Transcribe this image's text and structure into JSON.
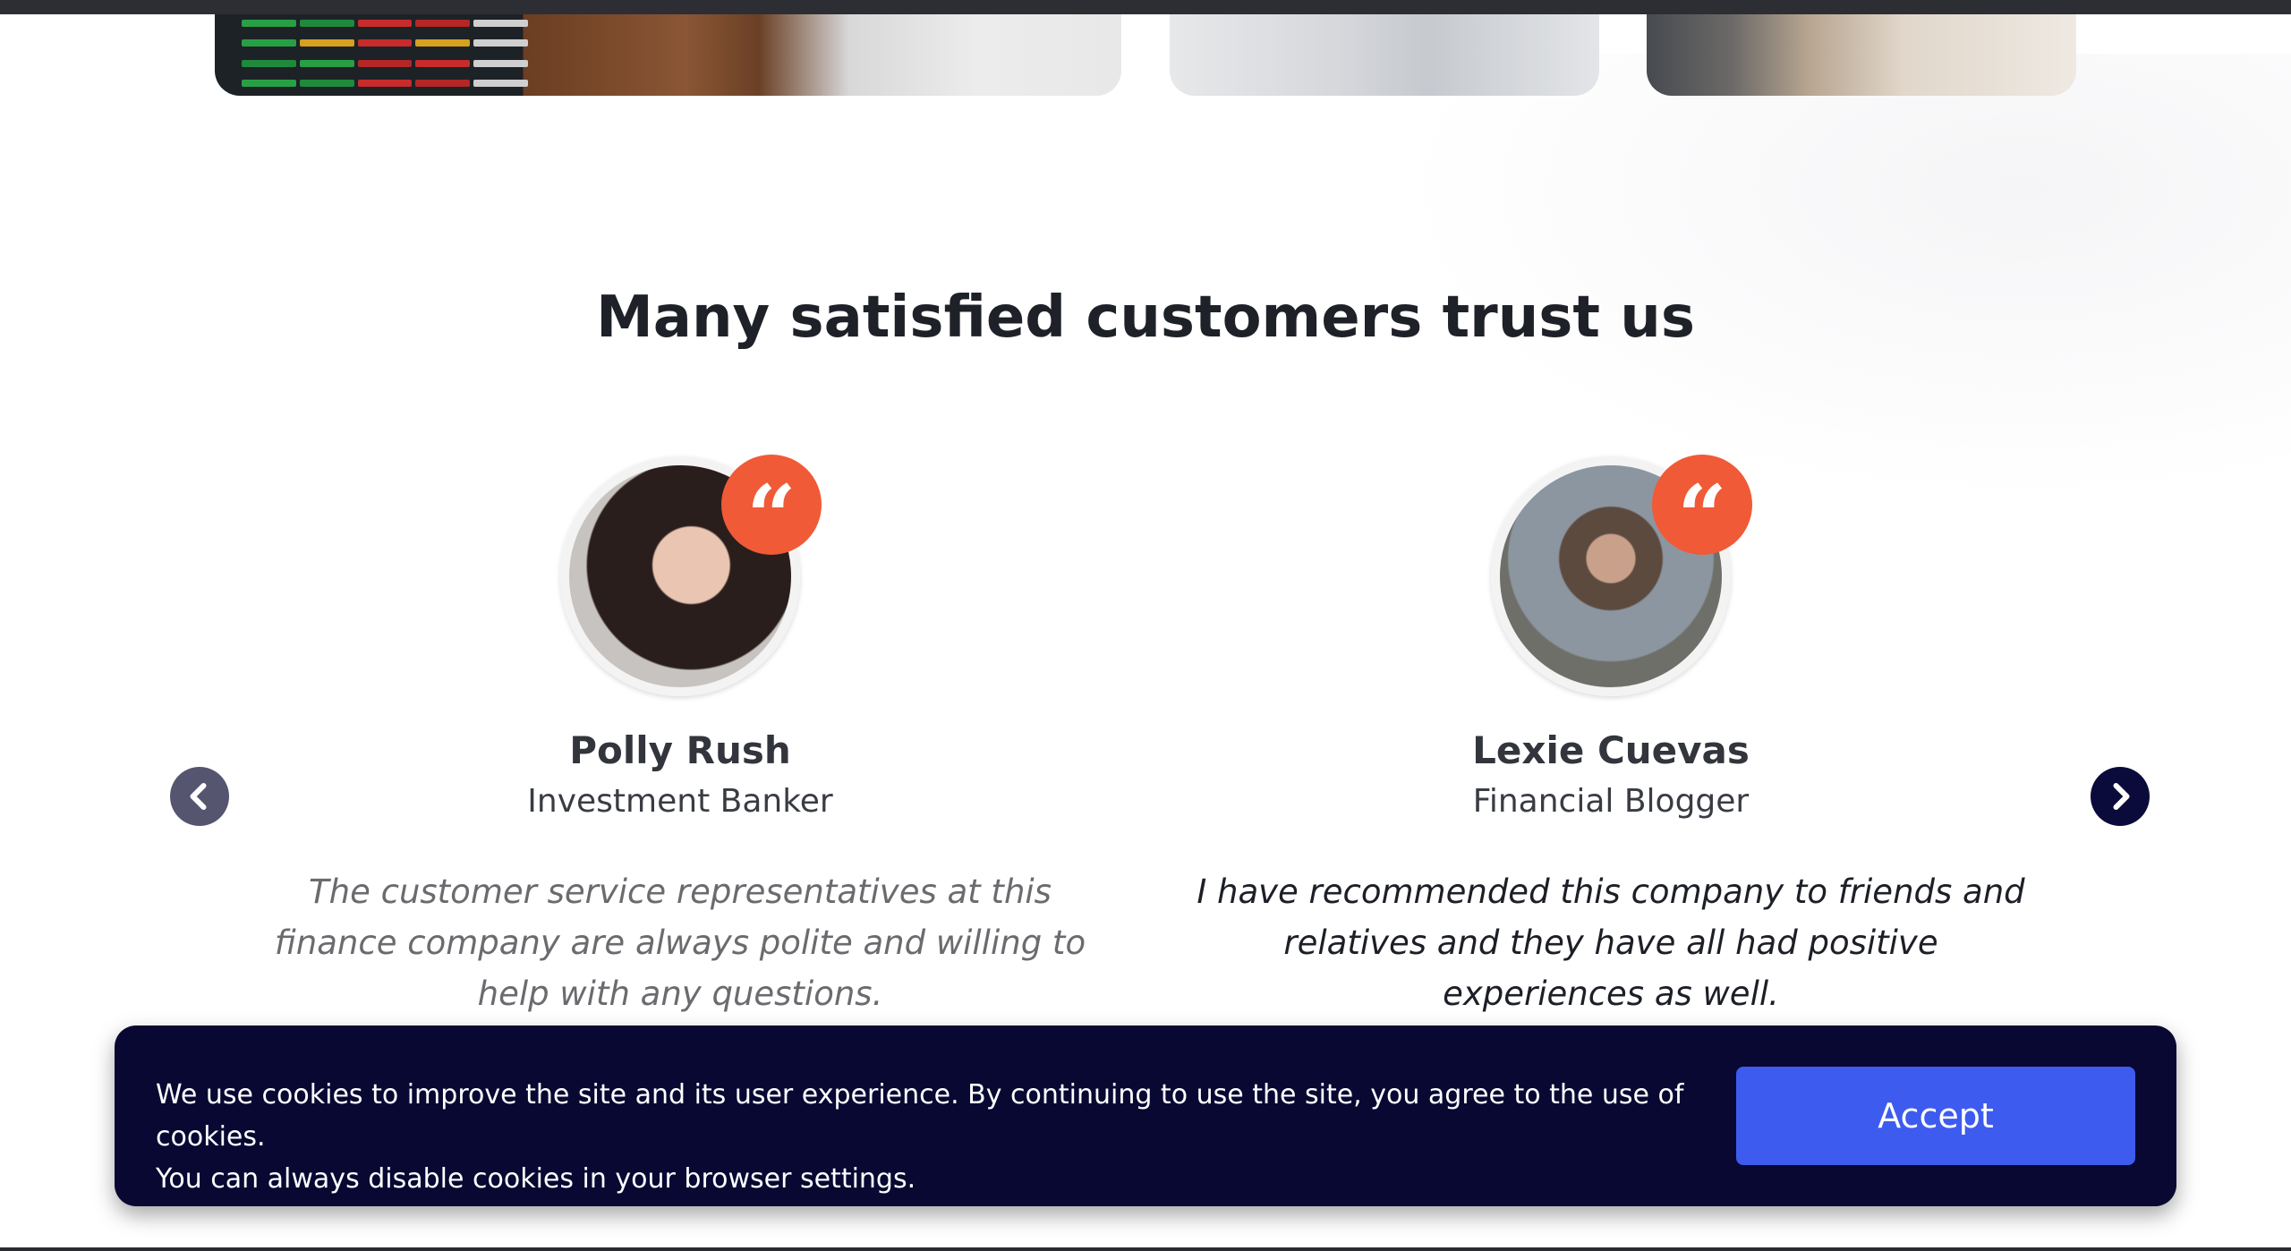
{
  "section": {
    "title": "Many satisfied customers trust us"
  },
  "testimonials": [
    {
      "name": "Polly Rush",
      "role": "Investment Banker",
      "quote": "The customer service representatives at this finance company are always polite and willing to help with any questions."
    },
    {
      "name": "Lexie Cuevas",
      "role": "Financial Blogger",
      "quote": "I have recommended this company to friends and relatives and they have all had positive experiences as well."
    }
  ],
  "icons": {
    "quote": "quote-icon",
    "prev": "chevron-left-icon",
    "next": "chevron-right-icon"
  },
  "cookie": {
    "text_line1": "We use cookies to improve the site and its user experience. By continuing to use the site, you agree to the use of cookies.",
    "text_line2": "You can always disable cookies in your browser settings.",
    "accept_label": "Accept"
  },
  "colors": {
    "accent": "#f05a36",
    "banner_bg": "#080833",
    "button": "#3e5bf0"
  }
}
